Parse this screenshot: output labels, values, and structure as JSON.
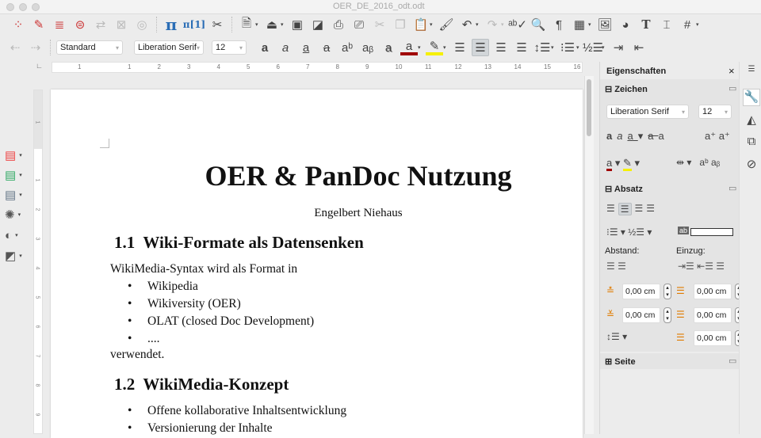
{
  "window": {
    "title": "OER_DE_2016_odt.odt"
  },
  "toolbar": {
    "style": "Standard",
    "font": "Liberation Serif",
    "size": "12"
  },
  "ruler": {
    "h": [
      "1",
      "1",
      "2",
      "3",
      "4",
      "5",
      "6",
      "7",
      "8",
      "9",
      "10",
      "11",
      "12",
      "13",
      "14",
      "15",
      "16"
    ],
    "v": [
      "1",
      "1",
      "2",
      "3",
      "4",
      "5",
      "6",
      "7",
      "8",
      "9"
    ]
  },
  "document": {
    "title": "OER & PanDoc Nutzung",
    "author": "Engelbert Niehaus",
    "h1": "1.1  Wiki-Formate als Datensenken",
    "p1": "WikiMedia-Syntax wird als Format in",
    "list1": [
      "Wikipedia",
      "Wikiversity (OER)",
      "OLAT (closed Doc Development)",
      "...."
    ],
    "p2": "verwendet.",
    "h2": "1.2  WikiMedia-Konzept",
    "list2": [
      "Offene kollaborative Inhaltsentwicklung",
      "Versionierung der Inhalte"
    ]
  },
  "sidebar": {
    "title": "Eigenschaften",
    "zeichen": {
      "label": "Zeichen",
      "font": "Liberation Serif",
      "size": "12"
    },
    "absatz": {
      "label": "Absatz",
      "abstand": "Abstand:",
      "einzug": "Einzug:",
      "above": "0,00 cm",
      "below": "0,00 cm",
      "before": "0,00 cm",
      "after": "0,00 cm",
      "first": "0,00 cm"
    },
    "seite": {
      "label": "Seite"
    }
  },
  "colors": {
    "font_color": "#a00000",
    "highlight": "#f5f000"
  }
}
